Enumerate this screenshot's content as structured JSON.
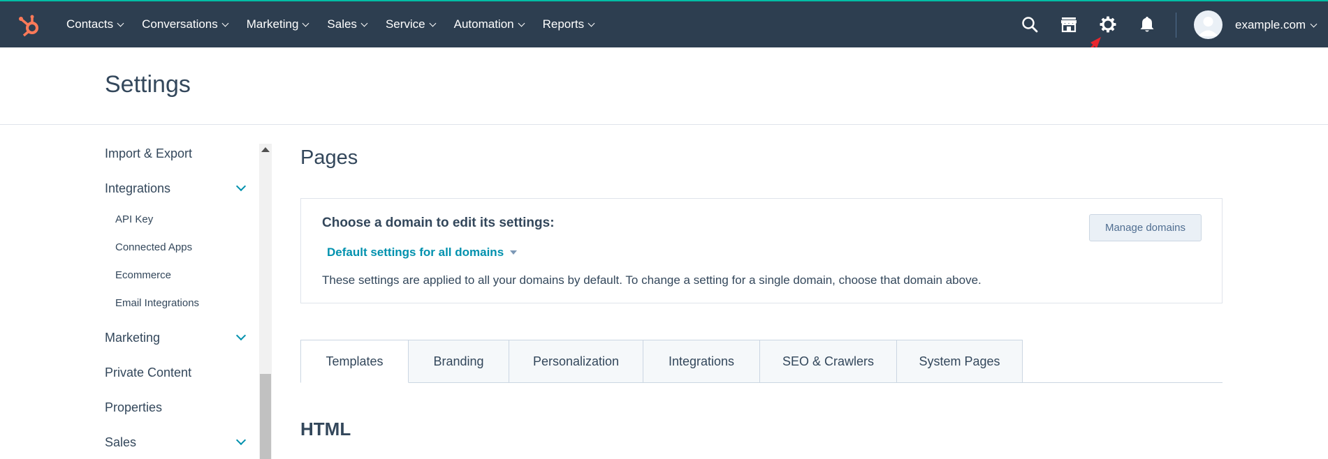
{
  "nav": {
    "items": [
      {
        "label": "Contacts"
      },
      {
        "label": "Conversations"
      },
      {
        "label": "Marketing"
      },
      {
        "label": "Sales"
      },
      {
        "label": "Service"
      },
      {
        "label": "Automation"
      },
      {
        "label": "Reports"
      }
    ],
    "account": "example.com"
  },
  "header": {
    "title": "Settings"
  },
  "sidebar": {
    "import_export": "Import & Export",
    "integrations": "Integrations",
    "api_key": "API Key",
    "connected_apps": "Connected Apps",
    "ecommerce": "Ecommerce",
    "email_integrations": "Email Integrations",
    "marketing": "Marketing",
    "private_content": "Private Content",
    "properties": "Properties",
    "sales": "Sales"
  },
  "main": {
    "title": "Pages",
    "domain": {
      "heading": "Choose a domain to edit its settings:",
      "selected": "Default settings for all domains",
      "description": "These settings are applied to all your domains by default. To change a setting for a single domain, choose that domain above.",
      "manage_label": "Manage domains"
    },
    "tabs": [
      {
        "label": "Templates"
      },
      {
        "label": "Branding"
      },
      {
        "label": "Personalization"
      },
      {
        "label": "Integrations"
      },
      {
        "label": "SEO & Crawlers"
      },
      {
        "label": "System Pages"
      }
    ],
    "section_title": "HTML"
  },
  "colors": {
    "nav_bg": "#2d3e50",
    "brand_orange": "#ff7a59",
    "accent_teal": "#0091ae",
    "annotation_red": "#e8262d"
  }
}
